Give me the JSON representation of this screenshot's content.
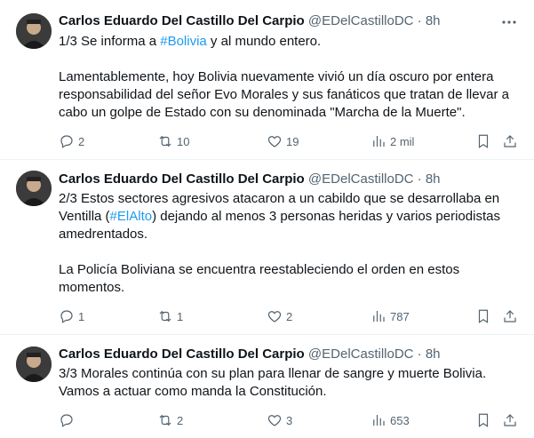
{
  "tweets": [
    {
      "author_name": "Carlos Eduardo Del Castillo Del Carpio",
      "meta": "@EDelCastilloDC · 8h",
      "line1_prefix": "1/3 Se informa a ",
      "line1_link": "#Bolivia",
      "line1_suffix": " y al mundo entero.",
      "paragraph2": "Lamentablemente, hoy Bolivia nuevamente vivió un día oscuro por entera responsabilidad del señor Evo Morales y sus fanáticos que tratan de llevar a cabo un golpe de Estado con su denominada \"Marcha de la Muerte\".",
      "replies": "2",
      "retweets": "10",
      "likes": "19",
      "views": "2 mil"
    },
    {
      "author_name": "Carlos Eduardo Del Castillo Del Carpio",
      "meta": "@EDelCastilloDC · 8h",
      "p1_prefix": "2/3 Estos sectores agresivos atacaron a un cabildo que se desarrollaba en Ventilla (",
      "p1_link": "#ElAlto",
      "p1_suffix": ") dejando al menos 3 personas heridas y varios periodistas amedrentados.",
      "paragraph2": "La Policía Boliviana se encuentra reestableciendo el orden en estos momentos.",
      "replies": "1",
      "retweets": "1",
      "likes": "2",
      "views": "787"
    },
    {
      "author_name": "Carlos Eduardo Del Castillo Del Carpio",
      "meta": "@EDelCastilloDC · 8h",
      "text": "3/3 Morales continúa con su plan para llenar de sangre y muerte Bolivia. Vamos a actuar como manda la Constitución.",
      "replies": "",
      "retweets": "2",
      "likes": "3",
      "views": "653"
    }
  ],
  "icons": {
    "reply": "reply-icon",
    "retweet": "retweet-icon",
    "like": "heart-icon",
    "views": "views-icon",
    "bookmark": "bookmark-icon",
    "share": "share-icon",
    "more": "more-icon"
  },
  "colors": {
    "link": "#1d9bf0",
    "text": "#0f1419",
    "muted": "#536471"
  }
}
